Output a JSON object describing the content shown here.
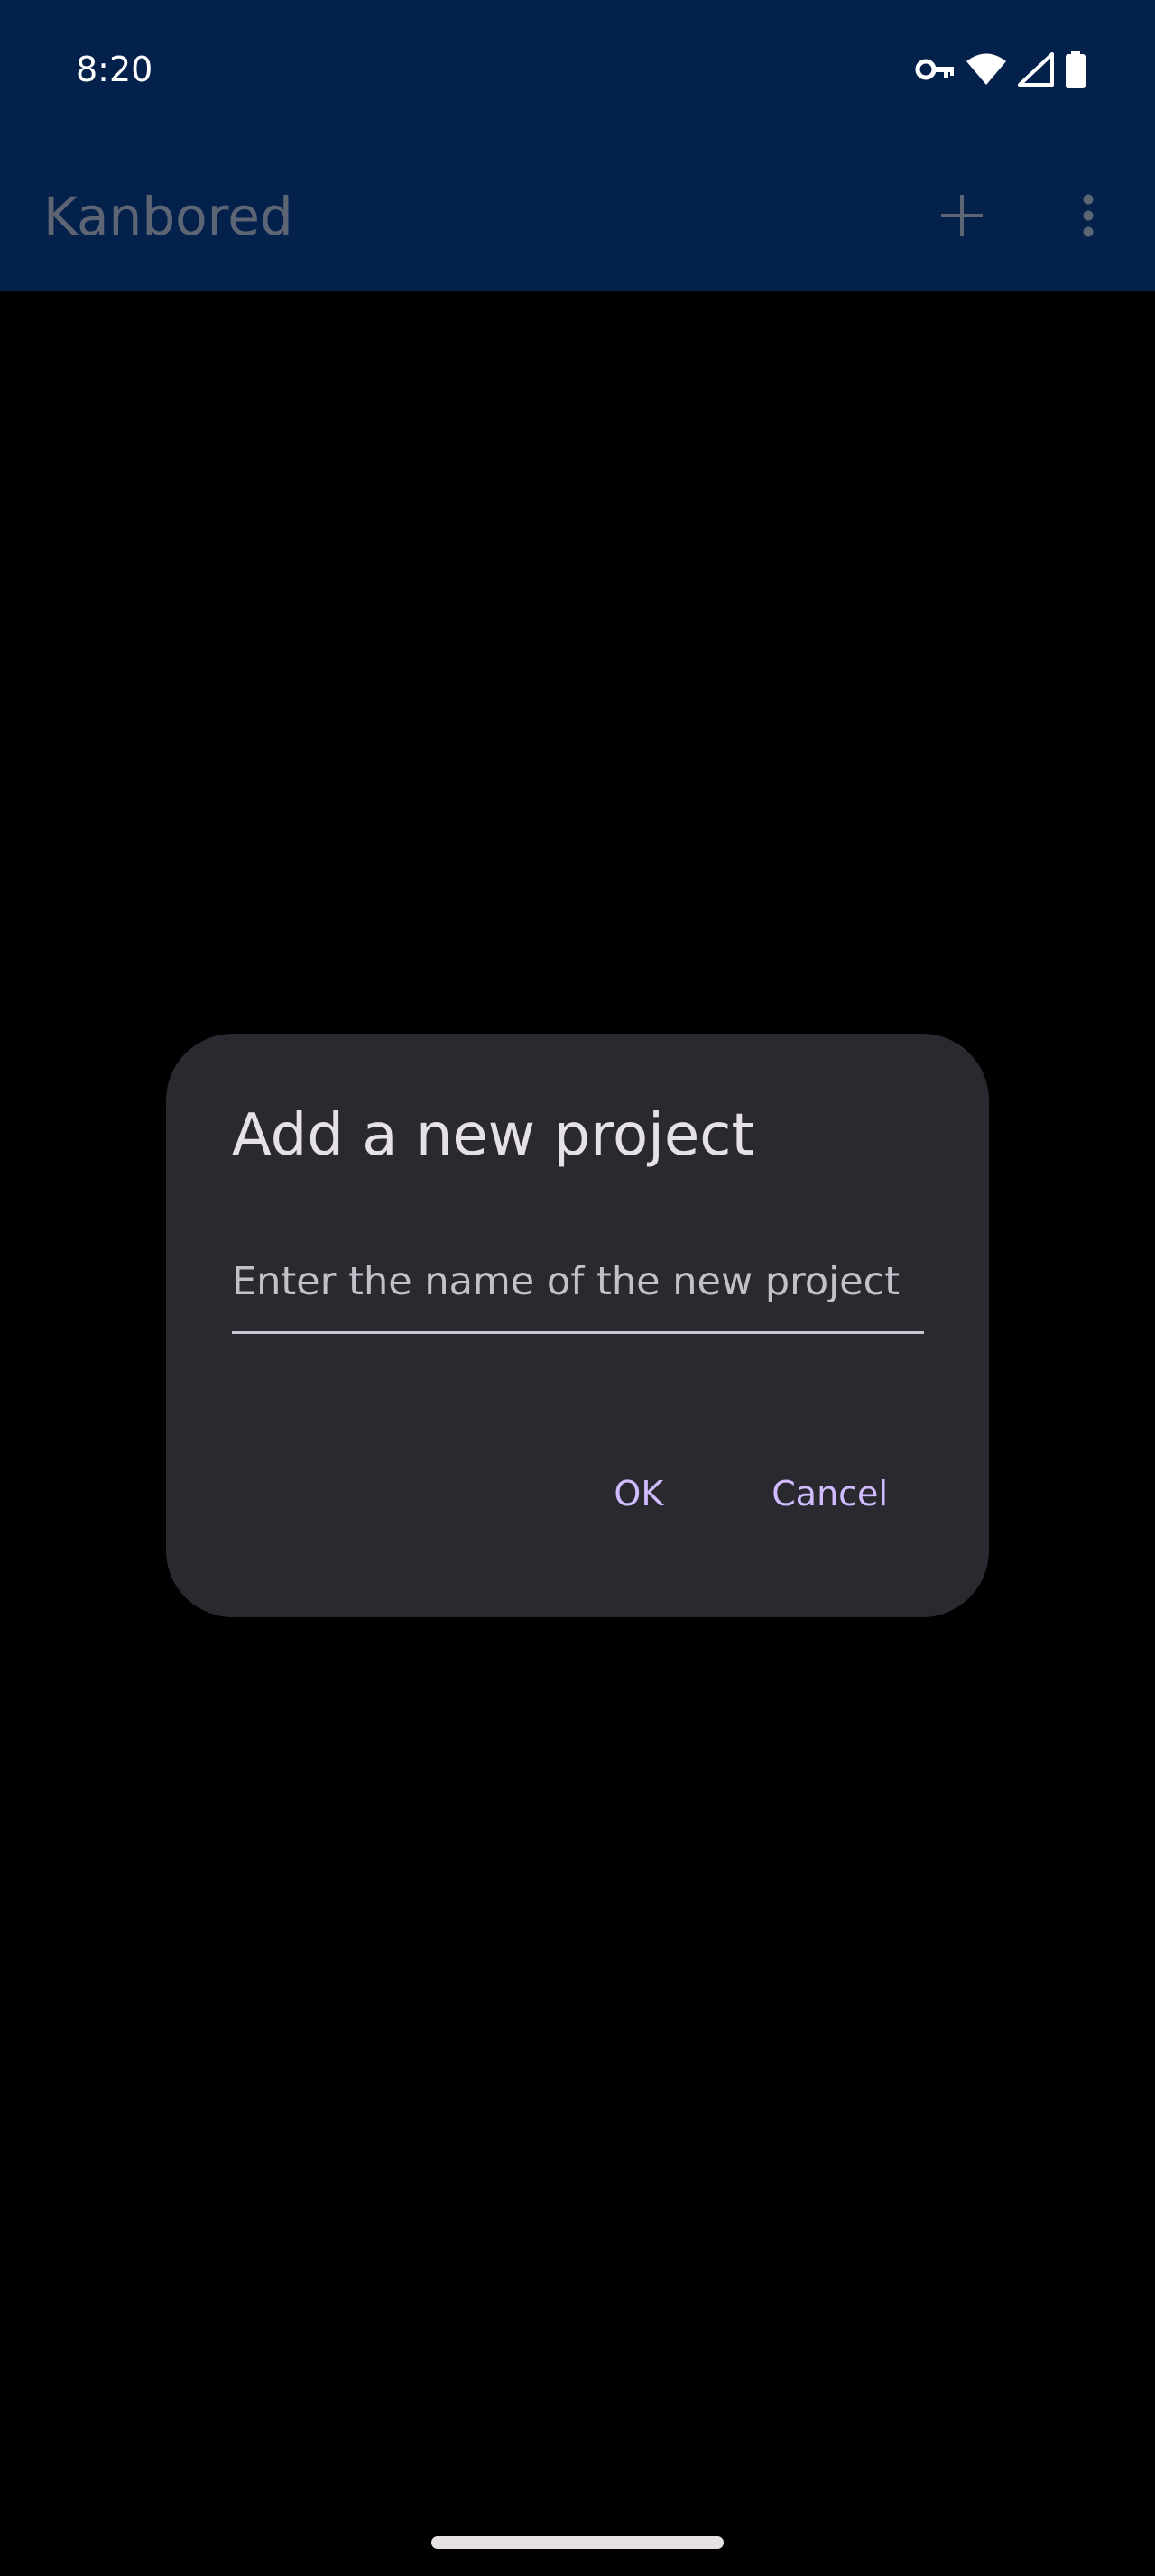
{
  "status_bar": {
    "time": "8:20",
    "icons": [
      "vpn-key-icon",
      "wifi-icon",
      "cell-signal-icon",
      "battery-icon"
    ]
  },
  "app_bar": {
    "title": "Kanbored",
    "actions": [
      "add-icon",
      "more-vertical-icon"
    ]
  },
  "dialog": {
    "title": "Add a new project",
    "input": {
      "value": "",
      "placeholder": "Enter the name of the new project"
    },
    "ok_label": "OK",
    "cancel_label": "Cancel"
  },
  "colors": {
    "app_bar_bg": "#04214c",
    "dialog_bg": "#2b2930",
    "accent": "#d0bcff",
    "app_title": "#5d6575"
  }
}
